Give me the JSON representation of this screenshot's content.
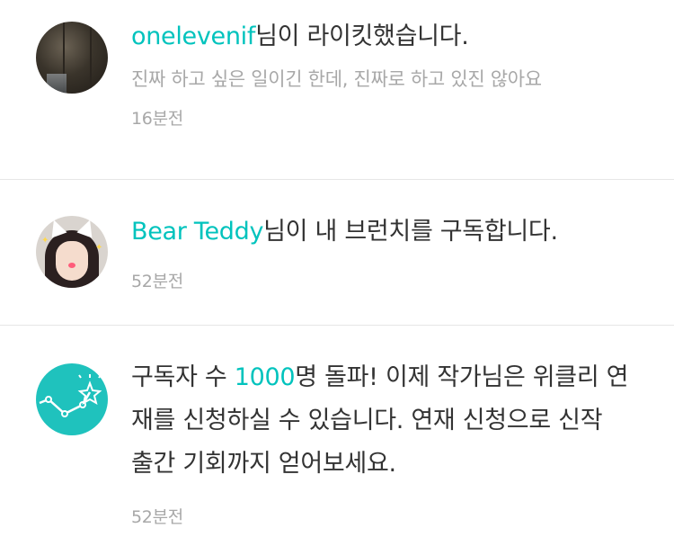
{
  "notifications": [
    {
      "user": "onelevenif",
      "action": "님이 라이킷했습니다.",
      "comment": "진짜 하고 싶은 일이긴 한데, 진짜로 하고 있진 않아요",
      "time": "16분전",
      "avatar": "user-photo"
    },
    {
      "user": "Bear Teddy",
      "action": "님이 내 브런치를 구독합니다.",
      "time": "52분전",
      "avatar": "user-photo"
    },
    {
      "text_before": "구독자 수 ",
      "highlight": "1000",
      "text_after": "명 돌파! 이제 작가님은 위클리 연재를 신청하실 수 있습니다. 연재 신청으로 신작 출간 기회까지 얻어보세요.",
      "time": "52분전",
      "avatar": "stats-icon"
    }
  ],
  "colors": {
    "accent": "#00c3bd",
    "text": "#333333",
    "muted": "#a8a8a8",
    "divider": "#e6e6e6"
  }
}
